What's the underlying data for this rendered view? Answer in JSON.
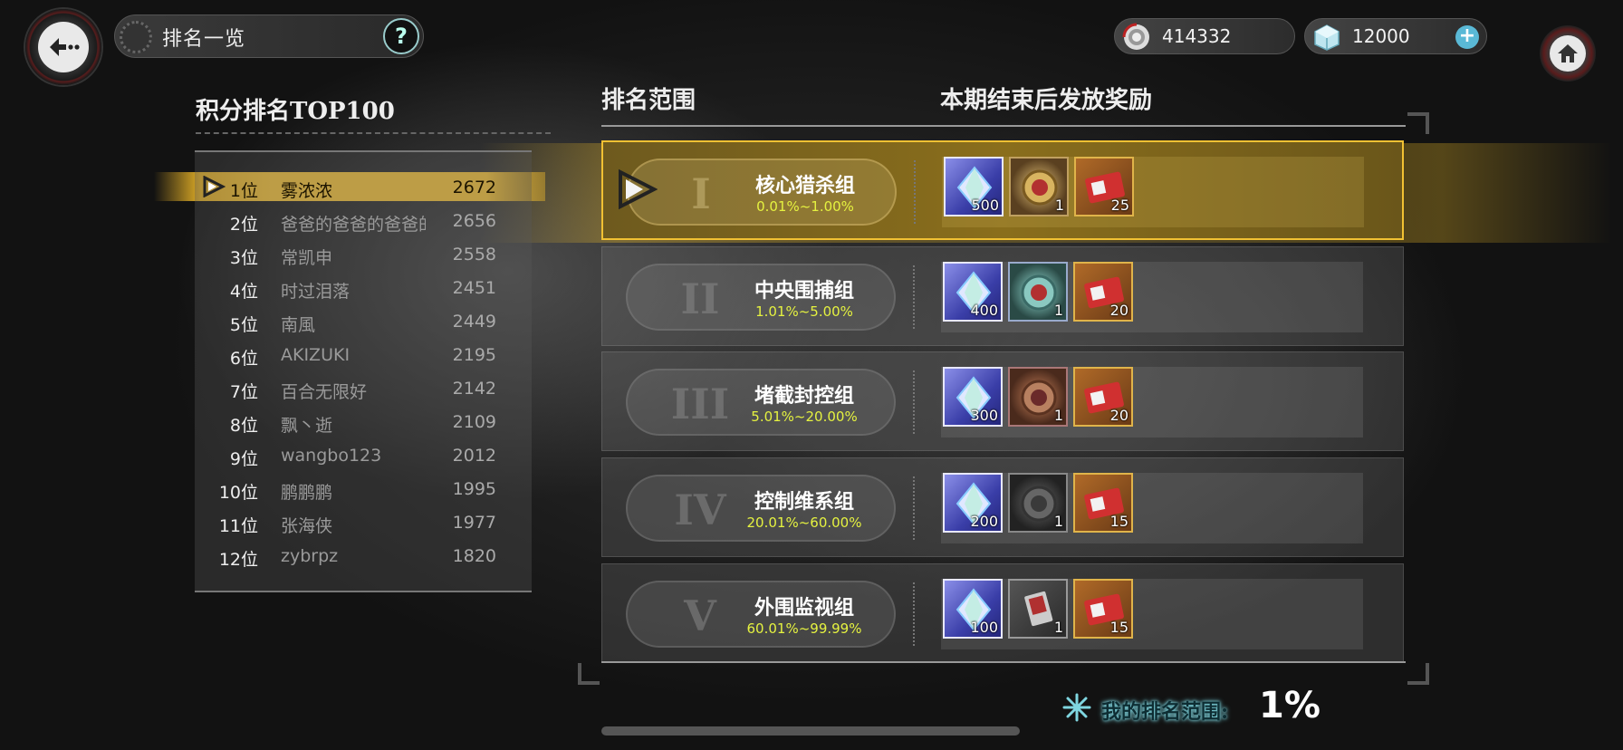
{
  "header": {
    "title": "排名一览",
    "help_label": "?",
    "currency_1": {
      "icon": "coin-icon",
      "value": "414332"
    },
    "currency_2": {
      "icon": "crystal-cube-icon",
      "value": "12000",
      "add_label": "+"
    }
  },
  "leaderboard": {
    "title": "积分排名TOP100",
    "rows": [
      {
        "rank": "1位",
        "name": "雾浓浓",
        "score": "2672"
      },
      {
        "rank": "2位",
        "name": "爸爸的爸爸的爸爸的",
        "score": "2656"
      },
      {
        "rank": "3位",
        "name": "常凯申",
        "score": "2558"
      },
      {
        "rank": "4位",
        "name": "时过泪落",
        "score": "2451"
      },
      {
        "rank": "5位",
        "name": "南風",
        "score": "2449"
      },
      {
        "rank": "6位",
        "name": "AKIZUKI",
        "score": "2195"
      },
      {
        "rank": "7位",
        "name": "百合无限好",
        "score": "2142"
      },
      {
        "rank": "8位",
        "name": "飘丶逝",
        "score": "2109"
      },
      {
        "rank": "9位",
        "name": "wangbo123",
        "score": "2012"
      },
      {
        "rank": "10位",
        "name": "鹏鹏鹏",
        "score": "1995"
      },
      {
        "rank": "11位",
        "name": "张海侠",
        "score": "1977"
      },
      {
        "rank": "12位",
        "name": "zybrpz",
        "score": "1820"
      }
    ]
  },
  "tiers_header": {
    "range": "排名范围",
    "reward": "本期结束后发放奖励"
  },
  "tiers": [
    {
      "roman": "I",
      "name": "核心猎杀组",
      "range": "0.01%~1.00%",
      "active": true,
      "rewards": [
        {
          "type": "crystal",
          "count": "500"
        },
        {
          "type": "medal-gold",
          "count": "1"
        },
        {
          "type": "ticket",
          "count": "25"
        }
      ]
    },
    {
      "roman": "II",
      "name": "中央围捕组",
      "range": "1.01%~5.00%",
      "active": false,
      "rewards": [
        {
          "type": "crystal",
          "count": "400"
        },
        {
          "type": "medal-teal",
          "count": "1"
        },
        {
          "type": "ticket",
          "count": "20"
        }
      ]
    },
    {
      "roman": "III",
      "name": "堵截封控组",
      "range": "5.01%~20.00%",
      "active": false,
      "rewards": [
        {
          "type": "crystal",
          "count": "300"
        },
        {
          "type": "medal-bronze",
          "count": "1"
        },
        {
          "type": "ticket",
          "count": "20"
        }
      ]
    },
    {
      "roman": "IV",
      "name": "控制维系组",
      "range": "20.01%~60.00%",
      "active": false,
      "rewards": [
        {
          "type": "crystal",
          "count": "200"
        },
        {
          "type": "medal-gray",
          "count": "1"
        },
        {
          "type": "ticket",
          "count": "15"
        }
      ]
    },
    {
      "roman": "V",
      "name": "外围监视组",
      "range": "60.01%~99.99%",
      "active": false,
      "rewards": [
        {
          "type": "crystal",
          "count": "100"
        },
        {
          "type": "card",
          "count": "1"
        },
        {
          "type": "ticket",
          "count": "15"
        }
      ]
    }
  ],
  "my_rank": {
    "label": "我的排名范围:",
    "value": "1%"
  },
  "colors": {
    "accent": "#f3c23c",
    "range_text": "#e5f240",
    "my_rank_glow": "#7fd6e0"
  }
}
